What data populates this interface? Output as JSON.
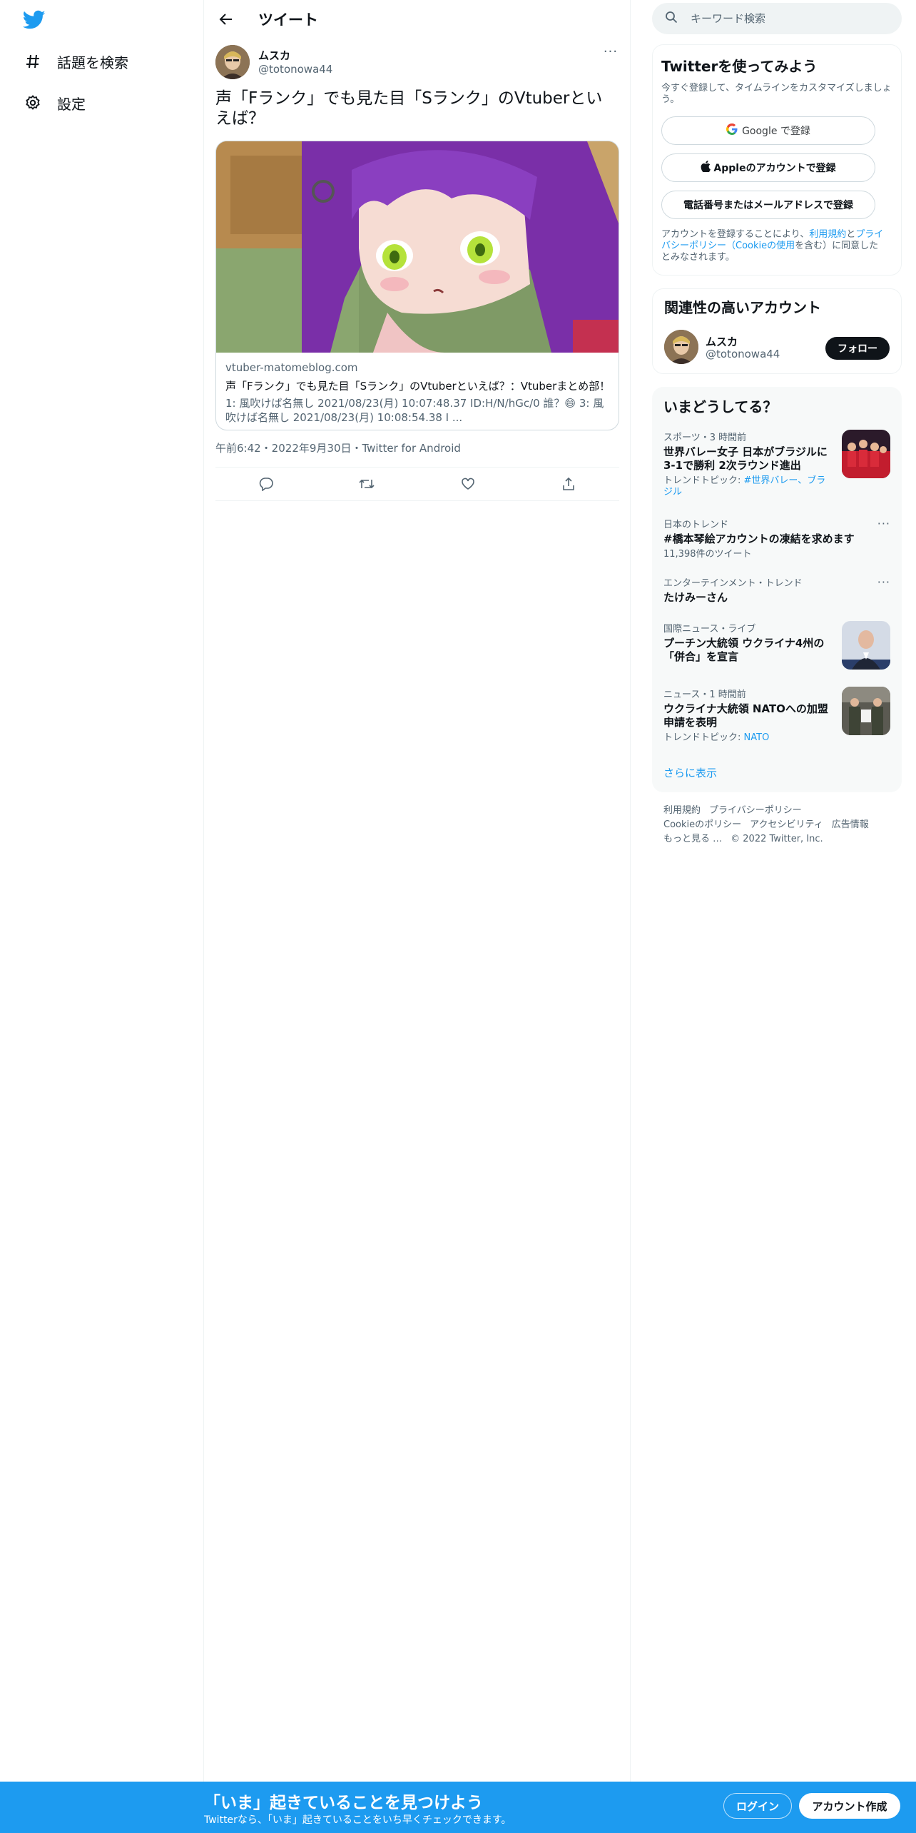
{
  "colors": {
    "brand": "#1d9bf0",
    "text": "#0f1419",
    "muted": "#536471"
  },
  "nav": {
    "explore_label": "話題を検索",
    "settings_label": "設定"
  },
  "header": {
    "title": "ツイート"
  },
  "tweet": {
    "author_name": "ムスカ",
    "author_handle": "@totonowa44",
    "text": "声「Fランク」でも見た目「Sランク」のVtuberといえば？",
    "card": {
      "domain": "vtuber-matomeblog.com",
      "title": "声「Fランク」でも見た目「Sランク」のVtuberといえば？：Vtuberまとめ部！",
      "description": "1: 風吹けば名無し 2021/08/23(月) 10:07:48.37 ID:H/N/hGc/0 誰？😄 3: 風吹けば名無し 2021/08/23(月) 10:08:54.38 I ..."
    },
    "time": "午前6:42・2022年9月30日・Twitter for Android"
  },
  "search": {
    "placeholder": "キーワード検索"
  },
  "signup_box": {
    "title": "Twitterを使ってみよう",
    "subtitle": "今すぐ登録して、タイムラインをカスタマイズしましょう。",
    "google_label": "Google で登録",
    "apple_label": "Appleのアカウントで登録",
    "phone_label": "電話番号またはメールアドレスで登録",
    "terms_prefix": "アカウントを登録することにより、",
    "terms_link": "利用規約",
    "terms_and": "と",
    "privacy_link": "プライバシーポリシー（Cookieの使用",
    "terms_suffix": "を含む）に同意したとみなされます。"
  },
  "related": {
    "title": "関連性の高いアカウント",
    "name": "ムスカ",
    "handle": "@totonowa44",
    "follow_label": "フォロー"
  },
  "trends": {
    "title": "いまどうしてる？",
    "items": [
      {
        "category": "スポーツ・3 時間前",
        "name": "世界バレー女子 日本がブラジルに3-1で勝利 2次ラウンド進出",
        "extra_prefix": "トレンドトピック: ",
        "extra_link": "#世界バレー、ブラジル"
      },
      {
        "category": "日本のトレンド",
        "name": "#橋本琴絵アカウントの凍結を求めます",
        "extra": "11,398件のツイート"
      },
      {
        "category": "エンターテインメント・トレンド",
        "name": "たけみーさん"
      },
      {
        "category": "国際ニュース・ライブ",
        "name": "プーチン大統領 ウクライナ4州の「併合」を宣言"
      },
      {
        "category": "ニュース・1 時間前",
        "name": "ウクライナ大統領 NATOへの加盟申請を表明",
        "extra_prefix": "トレンドトピック: ",
        "extra_link": "NATO"
      }
    ],
    "show_more": "さらに表示"
  },
  "footer": {
    "terms": "利用規約",
    "privacy": "プライバシーポリシー",
    "cookie": "Cookieのポリシー",
    "accessibility": "アクセシビリティ",
    "ads": "広告情報",
    "more": "もっと見る …",
    "copyright": "© 2022 Twitter, Inc."
  },
  "bottom_bar": {
    "title": "「いま」起きていることを見つけよう",
    "subtitle": "Twitterなら、「いま」起きていることをいち早くチェックできます。",
    "login_label": "ログイン",
    "signup_label": "アカウント作成"
  }
}
